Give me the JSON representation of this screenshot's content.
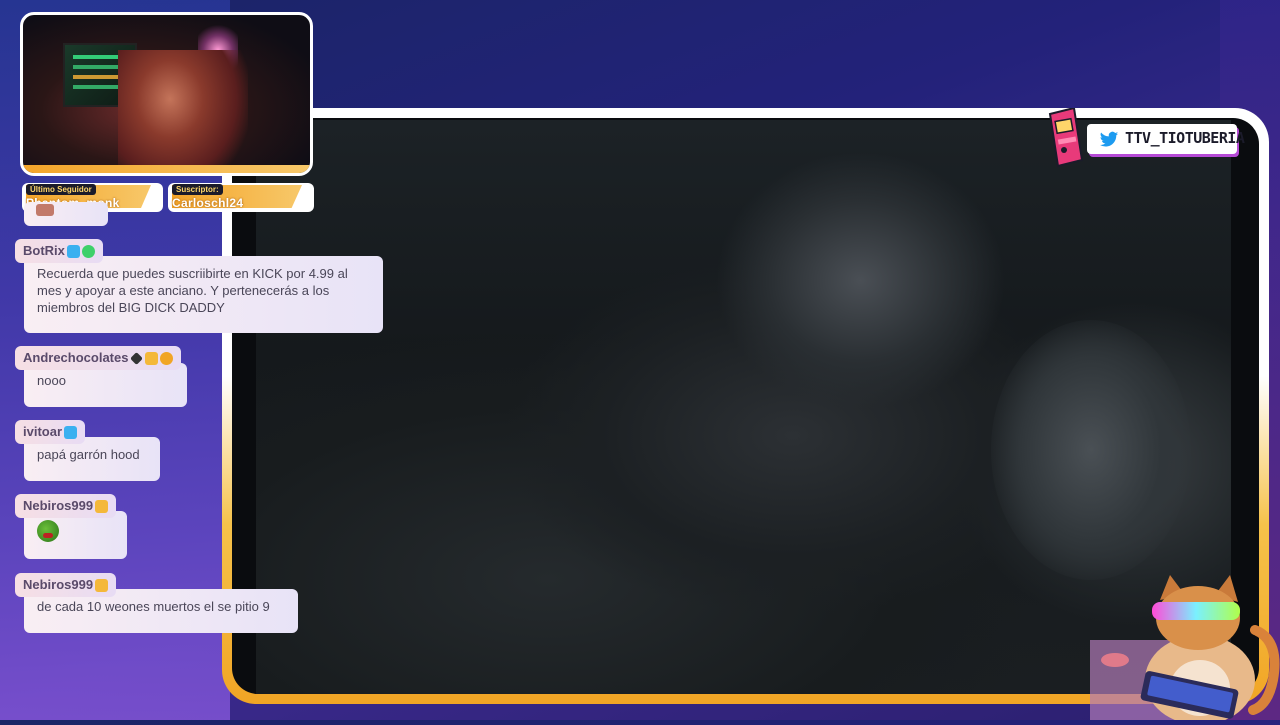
{
  "stream": {
    "twitter_handle": "TTV_TIOTUBERIA",
    "latest_follower": {
      "label": "Último Seguidor",
      "value": "Phantom_monk"
    },
    "subscriber": {
      "label": "Suscriptor:",
      "value": "Carloschl24"
    }
  },
  "chat": {
    "messages": [
      {
        "user": "BotRix",
        "text": "Recuerda que puedes suscriibirte en KICK por 4.99 al mes y apoyar a este anciano. Y pertenecerás a los miembros del BIG DICK DADDY"
      },
      {
        "user": "Andrechocolates",
        "text": "nooo"
      },
      {
        "user": "ivitoar",
        "text": "papá garrón hood"
      },
      {
        "user": "Nebiros999",
        "text": "",
        "emote": "pepe-emote"
      },
      {
        "user": "Nebiros999",
        "text": "de cada 10 weones muertos el se pitio 9"
      }
    ]
  },
  "colors": {
    "accent_orange": "#f4a52a",
    "accent_purple": "#b64ad6",
    "frame_white": "#ffffff"
  }
}
